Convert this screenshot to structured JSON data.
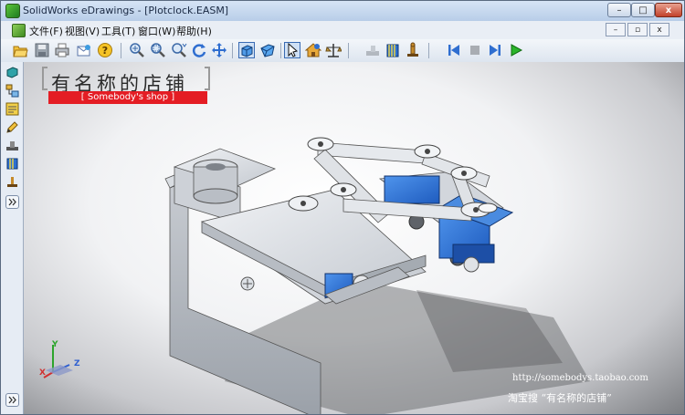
{
  "window": {
    "title": "SolidWorks eDrawings - [Plotclock.EASM]",
    "minimize_label": "–",
    "maximize_label": "□",
    "close_label": "x"
  },
  "menu": {
    "items": [
      {
        "label": "文件(F)"
      },
      {
        "label": "视图(V)"
      },
      {
        "label": "工具(T)"
      },
      {
        "label": "窗口(W)"
      },
      {
        "label": "帮助(H)"
      }
    ],
    "doc_min": "–",
    "doc_restore": "▫",
    "doc_close": "x"
  },
  "toolbar": {
    "icons": [
      "open-icon",
      "save-icon",
      "print-icon",
      "send-icon",
      "help-icon",
      "zoom-fit-icon",
      "zoom-area-icon",
      "zoom-icon",
      "rotate-icon",
      "pan-icon",
      "shaded-icon",
      "perspective-icon",
      "select-icon",
      "home-icon",
      "measure-icon",
      "stamp-icon",
      "section-icon",
      "markup-icon",
      "play-first-icon",
      "stop-icon",
      "next-icon",
      "play-icon"
    ]
  },
  "viewport": {
    "shop_name_cn": "有名称的店铺",
    "shop_name_en": "Somebody's shop",
    "url": "http://somebodys.taobao.com",
    "search_line": "淘宝搜 “有名称的店铺”",
    "axis": {
      "x": "X",
      "y": "Y",
      "z": "Z"
    }
  },
  "colors": {
    "accent": "#e41d24",
    "servo_blue": "#2d6fd0",
    "frame_grey": "#c9ced6"
  }
}
